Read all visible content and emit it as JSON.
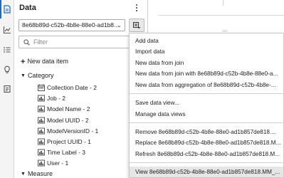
{
  "panel": {
    "title": "Data",
    "source_value": "8e68b89d-c52b-4b8e-88e0-ad1b8...",
    "filter_placeholder": "Filter",
    "new_item_label": "New data item"
  },
  "category": {
    "label": "Category",
    "items": [
      {
        "label": "Collection Date - 2",
        "icon": "calendar-icon"
      },
      {
        "label": "Job - 2",
        "icon": "category-icon"
      },
      {
        "label": "Model Name - 2",
        "icon": "category-icon"
      },
      {
        "label": "Model UUID - 2",
        "icon": "category-icon"
      },
      {
        "label": "ModelVersionID - 1",
        "icon": "category-icon"
      },
      {
        "label": "Project UUID - 1",
        "icon": "category-icon"
      },
      {
        "label": "Time Label - 3",
        "icon": "category-icon"
      },
      {
        "label": "User - 1",
        "icon": "category-icon"
      }
    ]
  },
  "measure": {
    "label": "Measure"
  },
  "canvas": {
    "ellipsis": "..."
  },
  "menu": {
    "items": [
      {
        "label": "Add data"
      },
      {
        "label": "Import data"
      },
      {
        "label": "New data from join"
      },
      {
        "label": "New data from join with 8e68b89d-c52b-4b8e-88e0-a..."
      },
      {
        "label": "New data from aggregation of 8e68b89d-c52b-4b8e-..."
      },
      {
        "label": "Save data view..."
      },
      {
        "label": "Manage data views"
      },
      {
        "label": "Remove 8e68b89d-c52b-4b8e-88e0-ad1b857de818...."
      },
      {
        "label": "Replace 8e68b89d-c52b-4b8e-88e0-ad1b857de818.M..."
      },
      {
        "label": "Refresh 8e68b89d-c52b-4b8e-88e0-ad1b857de818.M..."
      },
      {
        "label": "View 8e68b89d-c52b-4b8e-88e0-ad1b857de818.MM_..."
      }
    ]
  },
  "rail": {
    "icons": [
      "data-icon",
      "chart-icon",
      "list-icon",
      "lightbulb-icon",
      "report-icon"
    ]
  },
  "colors": {
    "accent": "#1b6ac9",
    "highlight": "#e6e6e6"
  }
}
